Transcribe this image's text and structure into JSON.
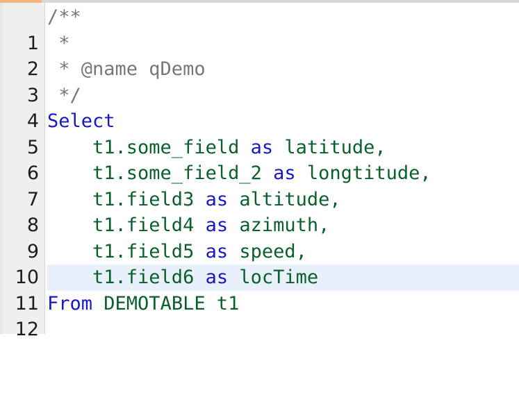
{
  "editor": {
    "colors": {
      "comment": "#777777",
      "keyword": "#1717c8",
      "identifier": "#0b5f2a",
      "current_line_bg": "#e8f0fb",
      "gutter_bg": "#efefef"
    },
    "current_line": 11,
    "lines": [
      {
        "number": "1",
        "segments": [
          {
            "type": "comment",
            "text": "/**"
          }
        ]
      },
      {
        "number": "2",
        "segments": [
          {
            "type": "comment",
            "text": " *"
          }
        ]
      },
      {
        "number": "3",
        "segments": [
          {
            "type": "comment",
            "text": " * @name qDemo"
          }
        ]
      },
      {
        "number": "4",
        "segments": [
          {
            "type": "comment",
            "text": " */"
          }
        ]
      },
      {
        "number": "5",
        "segments": [
          {
            "type": "keyword",
            "text": "Select"
          }
        ]
      },
      {
        "number": "6",
        "segments": [
          {
            "type": "ident",
            "text": "    t1.some_field "
          },
          {
            "type": "keyword",
            "text": "as"
          },
          {
            "type": "ident",
            "text": " latitude,"
          }
        ]
      },
      {
        "number": "7",
        "segments": [
          {
            "type": "ident",
            "text": "    t1.some_field_2 "
          },
          {
            "type": "keyword",
            "text": "as"
          },
          {
            "type": "ident",
            "text": " longtitude,"
          }
        ]
      },
      {
        "number": "8",
        "segments": [
          {
            "type": "ident",
            "text": "    t1.field3 "
          },
          {
            "type": "keyword",
            "text": "as"
          },
          {
            "type": "ident",
            "text": " altitude,"
          }
        ]
      },
      {
        "number": "9",
        "segments": [
          {
            "type": "ident",
            "text": "    t1.field4 "
          },
          {
            "type": "keyword",
            "text": "as"
          },
          {
            "type": "ident",
            "text": " azimuth,"
          }
        ]
      },
      {
        "number": "10",
        "segments": [
          {
            "type": "ident",
            "text": "    t1.field5 "
          },
          {
            "type": "keyword",
            "text": "as"
          },
          {
            "type": "ident",
            "text": " speed,"
          }
        ]
      },
      {
        "number": "11",
        "segments": [
          {
            "type": "ident",
            "text": "    t1.field6 "
          },
          {
            "type": "keyword",
            "text": "as"
          },
          {
            "type": "ident",
            "text": " locTime"
          }
        ]
      },
      {
        "number": "12",
        "segments": [
          {
            "type": "keyword",
            "text": "From"
          },
          {
            "type": "ident",
            "text": " DEMOTABLE t1"
          }
        ]
      }
    ]
  }
}
